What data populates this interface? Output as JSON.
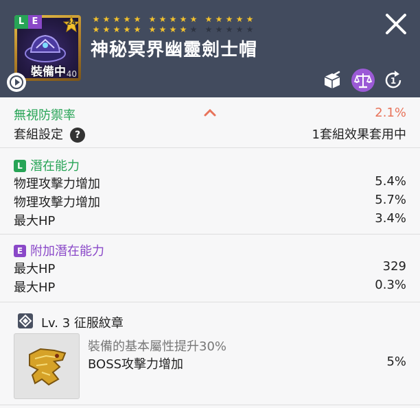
{
  "item": {
    "badge_l": "L",
    "badge_e": "E",
    "star_force": "24",
    "equipped_label": "裝備中",
    "level": "40",
    "name": "神秘冥界幽靈劍士帽",
    "stars_filled": 24,
    "stars_total": 30
  },
  "colors": {
    "header_bg": "#424b5e",
    "star_gold": "#f2c12e",
    "star_empty": "#2e3442",
    "legendary": "#27a456",
    "epic": "#8a48c8",
    "increase": "#e8735a"
  },
  "icons": {
    "close": "close-icon",
    "play": "play-icon",
    "box": "box-icon",
    "scale": "scale-icon",
    "refresh": "refresh-one-icon"
  },
  "stats": {
    "ignore_def_label": "無視防禦率",
    "ignore_def_value": "2.1%",
    "set_label": "套組設定",
    "set_help": "?",
    "set_value": "1套組效果套用中"
  },
  "potential": {
    "tag": "L",
    "title": "潛在能力",
    "lines": [
      {
        "label": "物理攻擊力增加",
        "value": "5.4%"
      },
      {
        "label": "物理攻擊力增加",
        "value": "5.7%"
      },
      {
        "label": "最大HP",
        "value": "3.4%"
      }
    ]
  },
  "additional_potential": {
    "tag": "E",
    "title": "附加潛在能力",
    "lines": [
      {
        "label": "最大HP",
        "value": "329"
      },
      {
        "label": "最大HP",
        "value": "0.3%"
      }
    ]
  },
  "emblem": {
    "title": "Lv. 3 征服紋章",
    "desc": "裝備的基本屬性提升30%",
    "stat_label": "BOSS攻擊力增加",
    "stat_value": "5%"
  }
}
